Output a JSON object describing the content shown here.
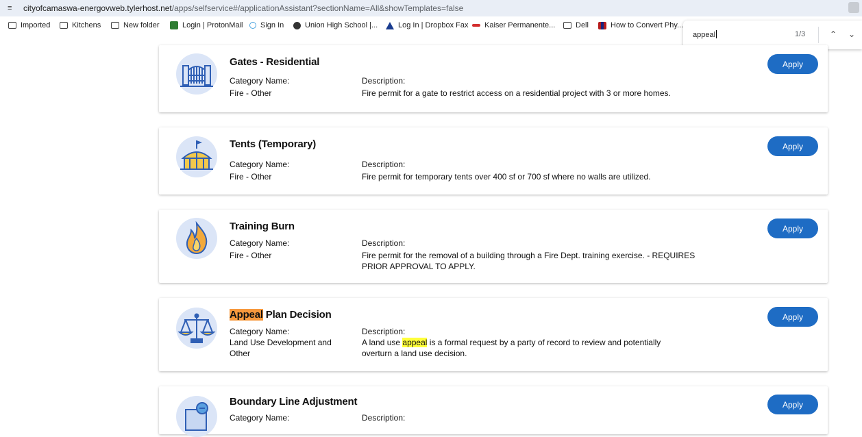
{
  "browser": {
    "url_host": "cityofcamaswa-energovweb.tylerhost.net",
    "url_path": "/apps/selfservice#/applicationAssistant?sectionName=All&showTemplates=false",
    "bookmarks": [
      {
        "label": "Imported",
        "icon": "folder-icon"
      },
      {
        "label": "Kitchens",
        "icon": "folder-icon"
      },
      {
        "label": "New folder",
        "icon": "folder-icon"
      },
      {
        "label": "Login | ProtonMail",
        "icon": "protonmail-icon"
      },
      {
        "label": "Sign In",
        "icon": "sign-in-icon"
      },
      {
        "label": "Union High School |...",
        "icon": "school-icon"
      },
      {
        "label": "Log In | Dropbox Fax",
        "icon": "dropbox-icon"
      },
      {
        "label": "Kaiser Permanente...",
        "icon": "kaiser-icon"
      },
      {
        "label": "Dell",
        "icon": "folder-icon"
      },
      {
        "label": "How to Convert Phy...",
        "icon": "flag-icon"
      }
    ]
  },
  "find_bar": {
    "query": "appeal",
    "count": "1/3",
    "prev_icon": "chevron-up-icon",
    "next_icon": "chevron-down-icon"
  },
  "cards": [
    {
      "title": "Gates - Residential",
      "icon": "gate-icon",
      "category_label": "Category Name:",
      "category_value": "Fire - Other",
      "description_label": "Description:",
      "description": "Fire permit for a gate to restrict access on a residential project with 3 or more homes.",
      "apply_label": "Apply"
    },
    {
      "title": "Tents (Temporary)",
      "icon": "tent-icon",
      "category_label": "Category Name:",
      "category_value": "Fire - Other",
      "description_label": "Description:",
      "description": "Fire permit for temporary tents over 400 sf or 700 sf where no walls are utilized.",
      "apply_label": "Apply"
    },
    {
      "title": "Training Burn",
      "icon": "fire-icon",
      "category_label": "Category Name:",
      "category_value": "Fire - Other",
      "description_label": "Description:",
      "description": "Fire permit for the removal of a building through a Fire Dept. training exercise. - REQUIRES PRIOR APPROVAL TO APPLY.",
      "apply_label": "Apply"
    },
    {
      "title_highlight": "Appeal",
      "title_rest": " Plan Decision",
      "icon": "scales-icon",
      "category_label": "Category Name:",
      "category_value": "Land Use Development and Other",
      "description_label": "Description:",
      "description_pre": "A land use ",
      "description_highlight": "appeal",
      "description_post": " is a formal request by a party of record to review and potentially overturn a land use decision.",
      "apply_label": "Apply"
    },
    {
      "title": "Boundary Line Adjustment",
      "icon": "map-boundary-icon",
      "category_label": "Category Name:",
      "description_label": "Description:",
      "apply_label": "Apply"
    }
  ],
  "colors": {
    "apply_button": "#1e6cc4",
    "current_match_highlight": "#f7993d",
    "match_highlight": "#ffff3b",
    "icon_circle": "#dbe5f7"
  }
}
